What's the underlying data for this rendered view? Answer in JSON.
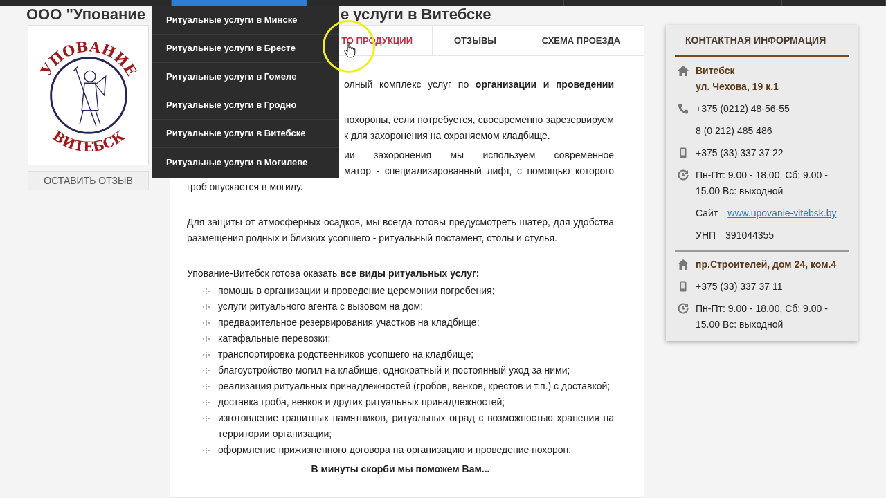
{
  "nav": {
    "items": [
      {
        "selected": false
      },
      {
        "selected": true
      },
      {
        "selected": false
      },
      {
        "selected": false
      },
      {
        "selected": false
      }
    ]
  },
  "title": {
    "left": "ООО \"Упование",
    "right": "е услуги в Витебске"
  },
  "dropdown": {
    "items": [
      "Ритуальные услуги в Минске",
      "Ритуальные услуги в Бресте",
      "Ритуальные услуги в Гомеле",
      "Ритуальные услуги в Гродно",
      "Ритуальные услуги в Витебске",
      "Ритуальные услуги в Могилеве"
    ]
  },
  "logo": {
    "top_text": "УПОВАНИЕ",
    "bottom_text": "ВИТЕБСК"
  },
  "review_button": "ОСТАВИТЬ ОТЗЫВ",
  "tabs": [
    {
      "label": "ТО ПРОДУКЦИИ",
      "selected": true
    },
    {
      "label": "ОТЗЫВЫ",
      "selected": false
    },
    {
      "label": "СХЕМА ПРОЕЗДА",
      "selected": false
    }
  ],
  "content": {
    "fragment_paragraphs": [
      [
        {
          "kind": "cut-justified",
          "text": "олный комплекс услуг по **организации и проведении**"
        }
      ],
      [
        {
          "kind": "cut-justified",
          "text": "похороны, если потребуется, своевременно зарезервируем"
        },
        {
          "kind": "cut-left",
          "text": "к для захоронения на охраняемом кладбище."
        }
      ],
      [
        {
          "kind": "cut-justified",
          "text": "ии захоронения мы используем современное"
        },
        {
          "kind": "cut-justified",
          "text": "матор - специализированный лифт, с помощью которого"
        },
        {
          "kind": "whole",
          "text": "гроб опускается в могилу."
        }
      ]
    ],
    "paragraph": "Для защиты от атмосферных осадков, мы всегда готовы предусмотреть шатер, для удобства размещения родных и близких усопшего - ритуальный постамент, столы и стулья.",
    "intro": "Упование-Витебск готова оказать **все виды ритуальных услуг:**",
    "services": [
      "помощь в организации и проведение церемонии погребения;",
      "услуги ритуального агента с вызовом на дом;",
      "предварительное резервирования участков на кладбище;",
      "катафальные перевозки;",
      "транспортировка родственников усопшего на кладбище;",
      "благоустройство могил на клабище, однократный и постоянный уход за ними;",
      "реализация ритуальных принадлежностей (гробов, венков, крестов и т.п.) с доставкой;",
      "доставка гроба, венков и других ритуальных принадлежностей;",
      "изготовление гранитных памятников, ритуальных оград с возможностью хранения на территории организации;",
      "оформление прижизненного договора на организацию и проведение похорон."
    ],
    "closing": "В минуты скорби мы поможем Вам..."
  },
  "contacts": {
    "title": "КОНТАКТНАЯ ИНФОРМАЦИЯ",
    "groups": [
      {
        "rows": [
          {
            "kind": "address",
            "text": "Витебск",
            "bold": true
          },
          {
            "kind": "plain",
            "text": "ул. Чехова, 19 к.1",
            "bold": true
          },
          {
            "kind": "phone",
            "text": "+375 (0212) 48-56-55",
            "bold": false
          },
          {
            "kind": "plain",
            "text": "8 (0 212) 485 486",
            "bold": false
          },
          {
            "kind": "mobile",
            "text": "+375 (33) 337 37 22",
            "bold": false
          },
          {
            "kind": "hours",
            "text": "Пн-Пт: 9.00 - 18.00, Сб: 9.00 - 15.00 Вс: выходной",
            "bold": false
          },
          {
            "kind": "plain",
            "label": "Сайт",
            "link": "www.upovanie-vitebsk.by"
          },
          {
            "kind": "plain",
            "label": "УНП",
            "text": "391044355",
            "bold": false
          }
        ]
      },
      {
        "rows": [
          {
            "kind": "address",
            "text": "пр.Строителей, дом 24, ком.4",
            "bold": true
          },
          {
            "kind": "mobile",
            "text": "+375 (33) 337 37 11",
            "bold": false
          },
          {
            "kind": "hours",
            "text": "Пн-Пт: 9.00 - 18.00, Сб: 9.00 - 15.00 Вс: выходной",
            "bold": false
          }
        ]
      }
    ]
  }
}
